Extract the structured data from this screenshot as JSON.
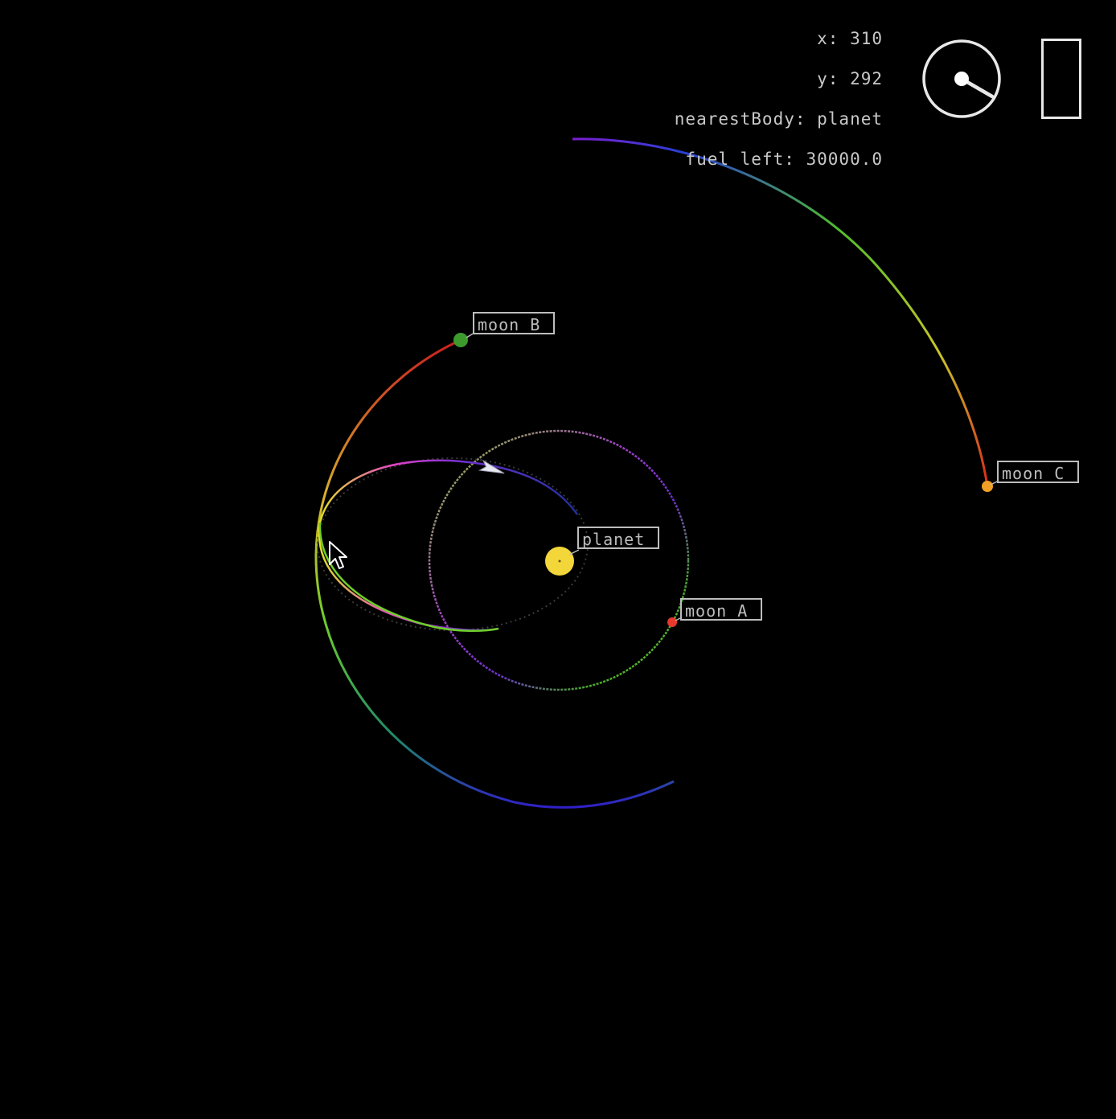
{
  "hud": {
    "x_readout": "x: 310",
    "y_readout": "y: 292",
    "nearest_body_readout": "nearestBody: planet",
    "fuel_readout": "fuel left: 30000.0"
  },
  "bodies": {
    "planet": {
      "label": "planet",
      "color": "#f3d63a"
    },
    "moon_a": {
      "label": "moon A",
      "color": "#e8392e"
    },
    "moon_b": {
      "label": "moon B",
      "color": "#3d9b2e"
    },
    "moon_c": {
      "label": "moon C",
      "color": "#f0a024"
    }
  },
  "controls": {
    "throttle_level": 0.0,
    "heading_dial_icon": "heading-dial-icon",
    "throttle_icon": "throttle-gauge-icon"
  },
  "colors": {
    "background": "#000000",
    "hud_text": "#c8c8c8",
    "label_border": "#bdbdbd",
    "ship": "#e8e8f0"
  }
}
